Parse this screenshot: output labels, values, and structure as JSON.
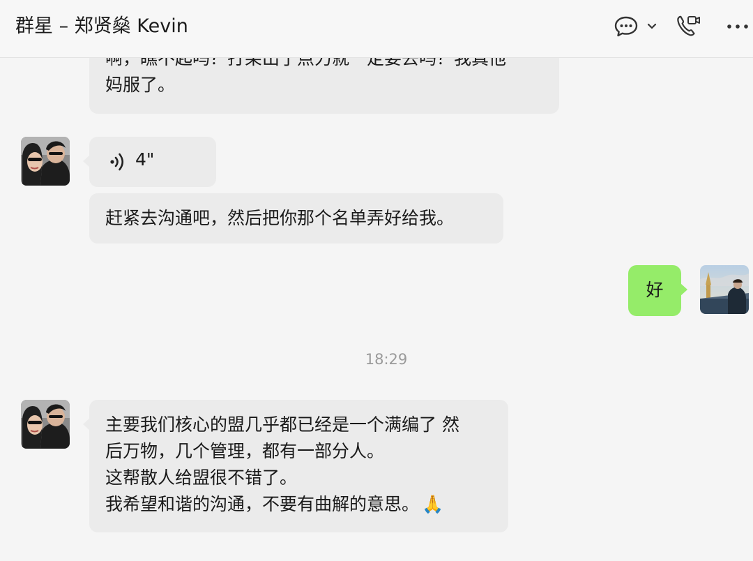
{
  "header": {
    "title": "群星 – 郑贤燊 Kevin",
    "icons": [
      "chat-bubble-icon",
      "chevron-down-icon",
      "video-call-icon",
      "more-icon"
    ]
  },
  "messages": {
    "partial_top": {
      "line1": "啊，瞧不起吗？打架出了点力就一定要去吗？我真他",
      "line2": "妈服了。"
    },
    "voice": {
      "duration": "4\""
    },
    "msg_urge": "赶紧去沟通吧，然后把你那个名单弄好给我。",
    "msg_self": "好",
    "timestamp": "18:29",
    "msg_long": {
      "line1": "主要我们核心的盟几乎都已经是一个满编了 然",
      "line2": "后万物，几个管理，都有一部分人。",
      "line3": "这帮散人给盟很不错了。",
      "line4": "我希望和谐的沟通，不要有曲解的意思。",
      "emoji": "🙏"
    }
  },
  "colors": {
    "background": "#f5f5f5",
    "incoming_bubble": "#ebebeb",
    "outgoing_bubble": "#95ec69",
    "timestamp": "#9a9a9a"
  }
}
